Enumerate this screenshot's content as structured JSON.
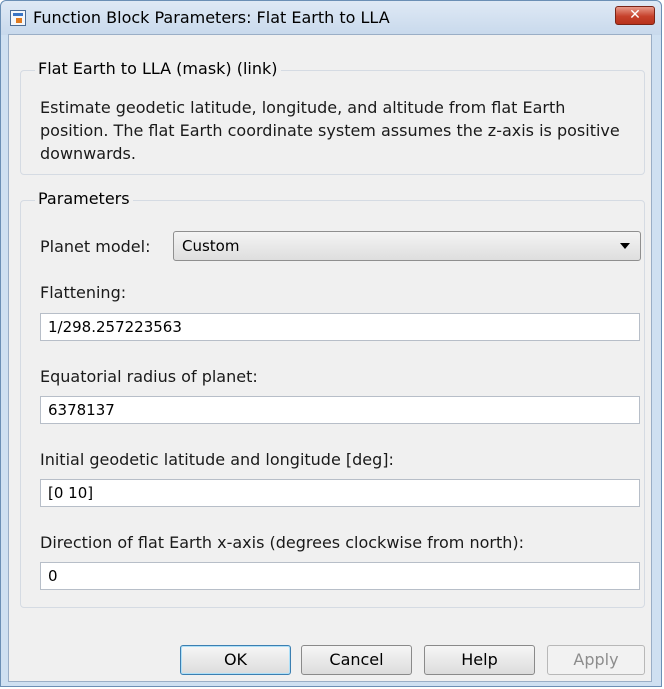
{
  "window": {
    "title": "Function Block Parameters: Flat Earth to LLA",
    "close_glyph": "✕"
  },
  "description_group": {
    "title": "Flat Earth to LLA (mask) (link)",
    "text": "Estimate geodetic latitude, longitude, and altitude from flat Earth position.  The flat Earth coordinate system assumes the z-axis is positive downwards."
  },
  "parameters": {
    "title": "Parameters",
    "planet_model": {
      "label": "Planet model:",
      "selected": "Custom"
    },
    "flattening": {
      "label": "Flattening:",
      "value": "1/298.257223563"
    },
    "equatorial_radius": {
      "label": "Equatorial radius of planet:",
      "value": "6378137"
    },
    "initial_lat_lon": {
      "label": "Initial geodetic latitude and longitude [deg]:",
      "value": "[0 10]"
    },
    "x_axis_direction": {
      "label": "Direction of flat Earth x-axis (degrees clockwise from north):",
      "value": "0"
    }
  },
  "buttons": {
    "ok": "OK",
    "cancel": "Cancel",
    "help": "Help",
    "apply": "Apply"
  },
  "colors": {
    "close_button": "#c6412b",
    "titlebar": "#c8d9ec",
    "dialog_bg": "#f0f0f0"
  }
}
